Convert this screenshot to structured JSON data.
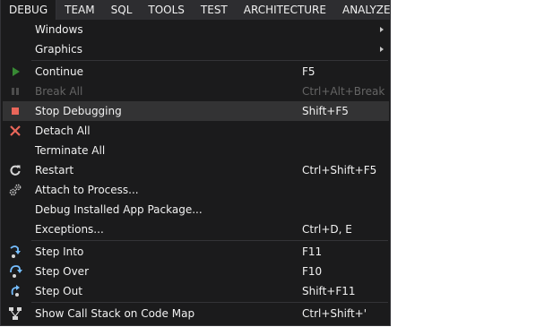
{
  "menubar": {
    "items": [
      "DEBUG",
      "TEAM",
      "SQL",
      "TOOLS",
      "TEST",
      "ARCHITECTURE",
      "ANALYZE"
    ]
  },
  "debug_menu": {
    "windows": {
      "label": "Windows"
    },
    "graphics": {
      "label": "Graphics"
    },
    "continue": {
      "label": "Continue",
      "shortcut": "F5"
    },
    "break_all": {
      "label": "Break All",
      "shortcut": "Ctrl+Alt+Break"
    },
    "stop_debugging": {
      "label": "Stop Debugging",
      "shortcut": "Shift+F5"
    },
    "detach_all": {
      "label": "Detach All"
    },
    "terminate_all": {
      "label": "Terminate All"
    },
    "restart": {
      "label": "Restart",
      "shortcut": "Ctrl+Shift+F5"
    },
    "attach_to_process": {
      "label": "Attach to Process..."
    },
    "debug_installed_app_package": {
      "label": "Debug Installed App Package..."
    },
    "exceptions": {
      "label": "Exceptions...",
      "shortcut": "Ctrl+D, E"
    },
    "step_into": {
      "label": "Step Into",
      "shortcut": "F11"
    },
    "step_over": {
      "label": "Step Over",
      "shortcut": "F10"
    },
    "step_out": {
      "label": "Step Out",
      "shortcut": "Shift+F11"
    },
    "show_call_stack_on_code_map": {
      "label": "Show Call Stack on Code Map",
      "shortcut": "Ctrl+Shift+'"
    }
  },
  "colors": {
    "menu_background": "#1b1b1c",
    "menubar_background": "#2d2d30",
    "hover_background": "#333334",
    "text": "#f1f1f1",
    "disabled_text": "#656565",
    "continue_icon": "#388a34",
    "stop_icon": "#e9665a",
    "detach_icon": "#e9665a",
    "step_icon": "#75beff"
  }
}
